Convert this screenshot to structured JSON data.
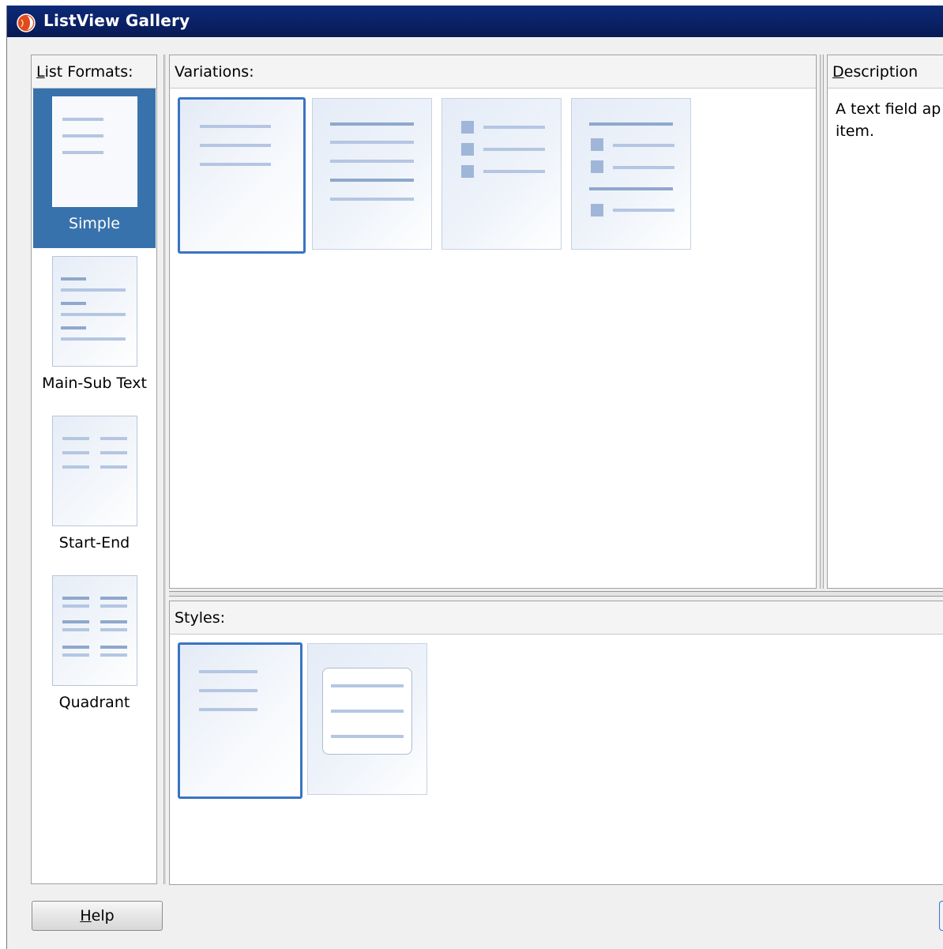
{
  "window": {
    "title": "ListView Gallery"
  },
  "list_formats": {
    "header": "List Formats:",
    "header_mnemonic": "L",
    "header_rest": "ist Formats:",
    "items": [
      {
        "label": "Simple",
        "selected": true
      },
      {
        "label": "Main-Sub Text",
        "selected": false
      },
      {
        "label": "Start-End",
        "selected": false
      },
      {
        "label": "Quadrant",
        "selected": false
      }
    ]
  },
  "variations": {
    "header": "Variations:",
    "selected_index": 0
  },
  "description": {
    "header": "Description",
    "header_mnemonic": "D",
    "header_rest": "escription",
    "text": "A text field ap item."
  },
  "styles": {
    "header": "Styles:",
    "selected_index": 0
  },
  "footer": {
    "help_label": "Help",
    "help_mnemonic": "H",
    "help_rest": "elp"
  },
  "colors": {
    "title_bar": "#0a2165",
    "selection": "#3872ac",
    "thumb_line": "#b4c6e2",
    "selected_border": "#3a74c4"
  }
}
